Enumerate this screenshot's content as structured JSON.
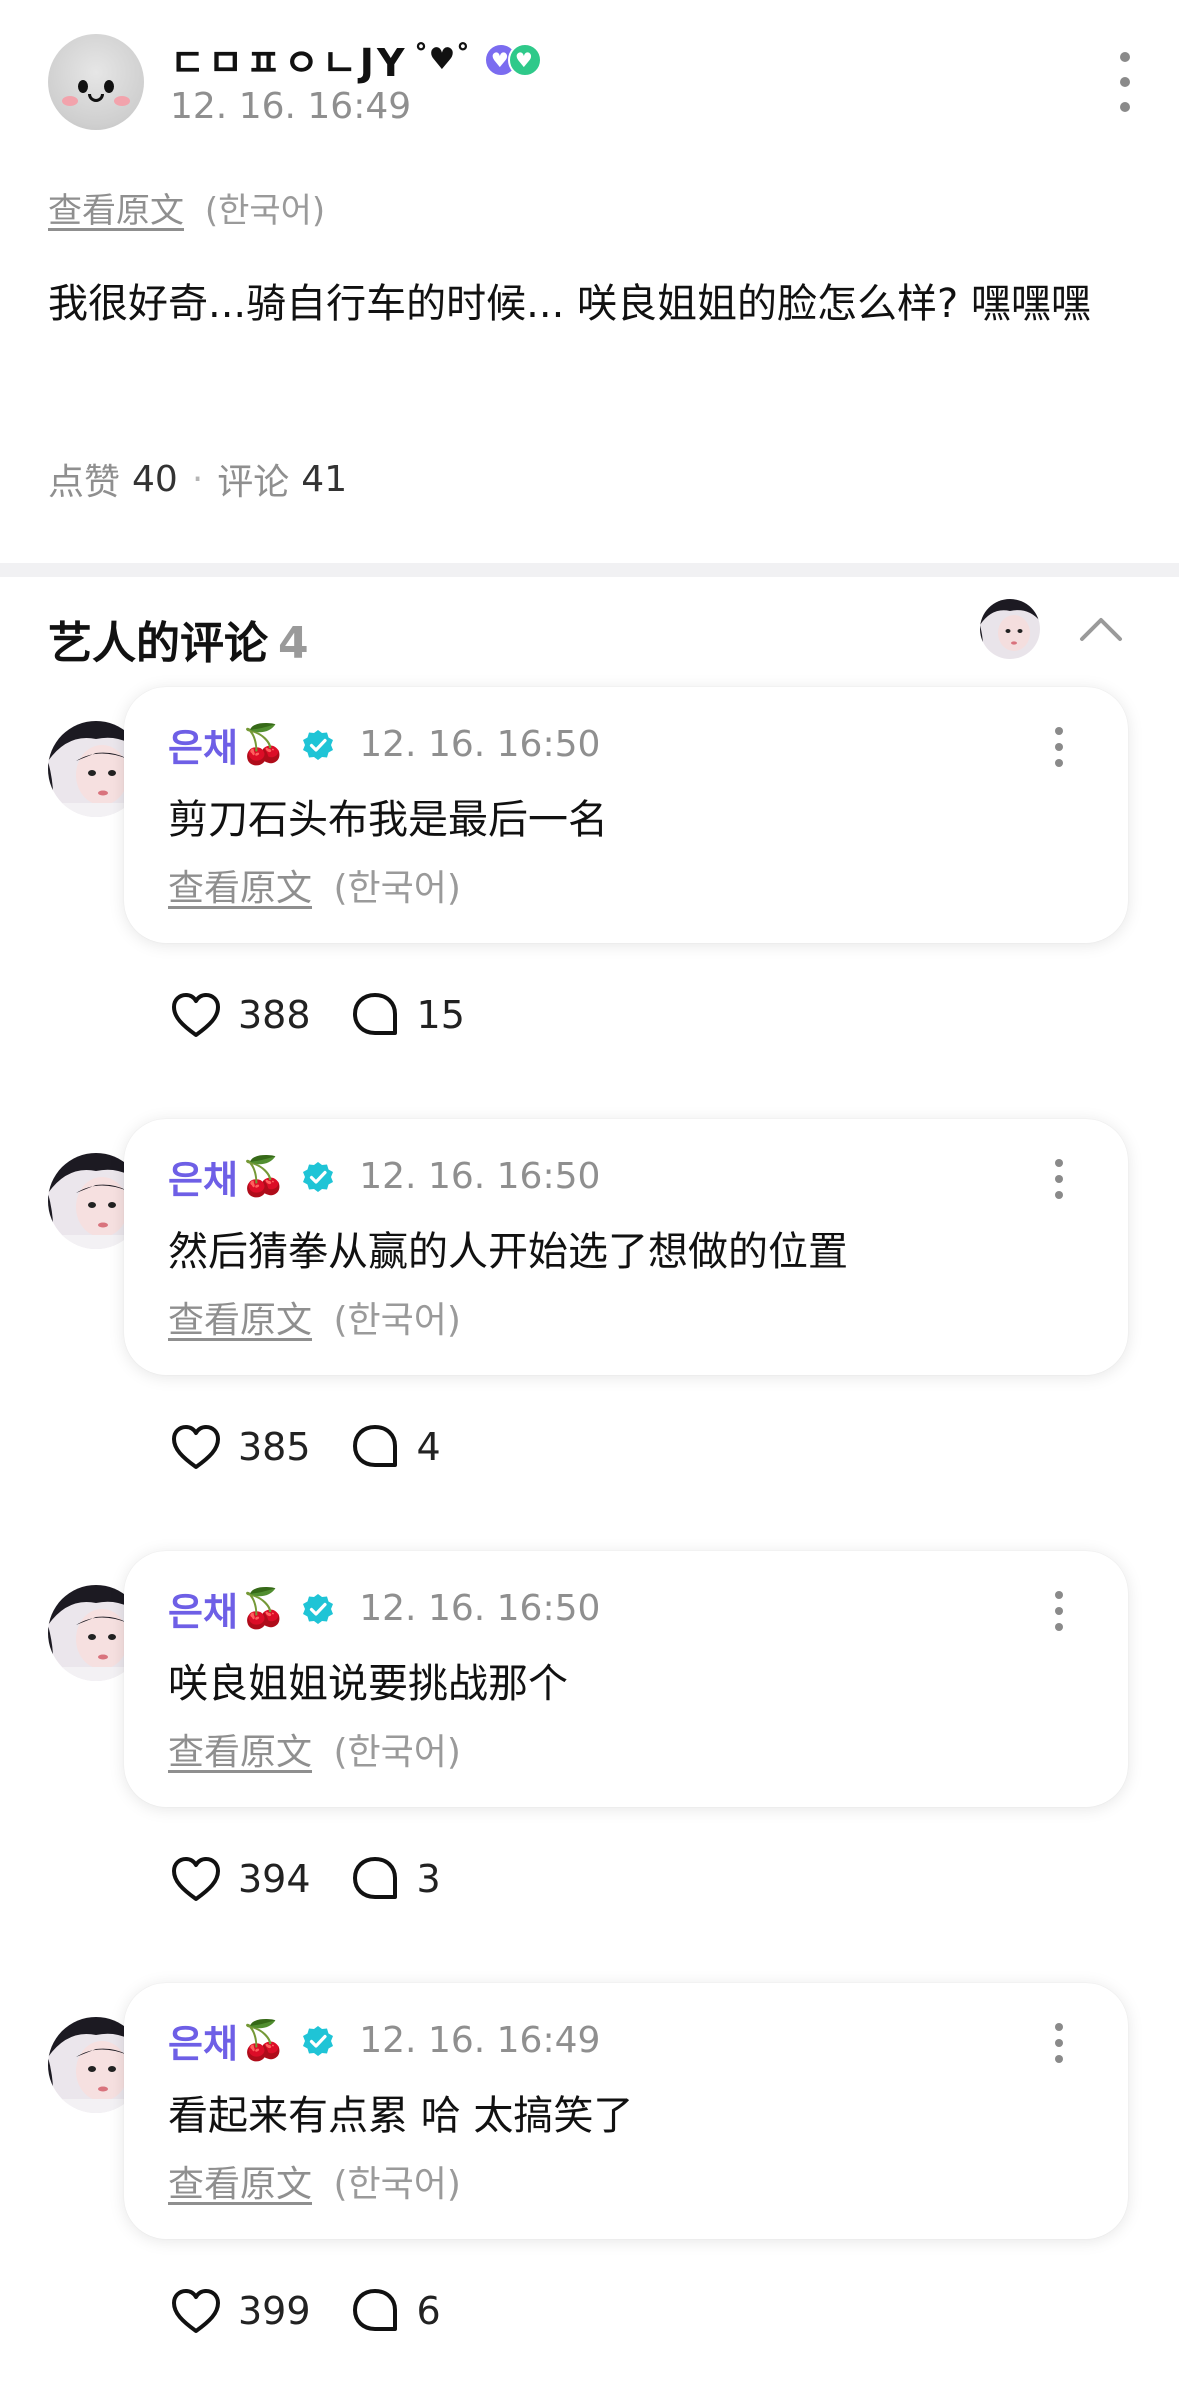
{
  "post": {
    "author": "ㄷㅁㅍㅇㄴJY",
    "author_deco": "˚♥˚",
    "badges": [
      "purple-heart-badge",
      "green-heart-badge"
    ],
    "time": "12. 16. 16:49",
    "translate_label": "查看原文",
    "translate_lang": "(한국어)",
    "body": "我很好奇...骑自行车的时候... 咲良姐姐的脸怎么样? 嘿嘿嘿",
    "likes_label": "点赞",
    "likes": "40",
    "comments_label": "评论",
    "comments": "41"
  },
  "section": {
    "title": "艺人的评论",
    "count": "4"
  },
  "comments": [
    {
      "name": "은채",
      "emoji": "🍒",
      "time": "12. 16. 16:50",
      "text": "剪刀石头布我是最后一名",
      "translate_label": "查看原文",
      "translate_lang": "(한국어)",
      "likes": "388",
      "replies": "15"
    },
    {
      "name": "은채",
      "emoji": "🍒",
      "time": "12. 16. 16:50",
      "text": "然后猜拳从赢的人开始选了想做的位置",
      "translate_label": "查看原文",
      "translate_lang": "(한국어)",
      "likes": "385",
      "replies": "4"
    },
    {
      "name": "은채",
      "emoji": "🍒",
      "time": "12. 16. 16:50",
      "text": "咲良姐姐说要挑战那个",
      "translate_label": "查看原文",
      "translate_lang": "(한국어)",
      "likes": "394",
      "replies": "3"
    },
    {
      "name": "은채",
      "emoji": "🍒",
      "time": "12. 16. 16:49",
      "text": "看起来有点累 哈 太搞笑了",
      "translate_label": "查看原文",
      "translate_lang": "(한국어)",
      "likes": "399",
      "replies": "6"
    }
  ],
  "colors": {
    "artist_name": "#6e5fe6",
    "verified": "#1fc4d6",
    "muted": "#8f8f8f"
  }
}
